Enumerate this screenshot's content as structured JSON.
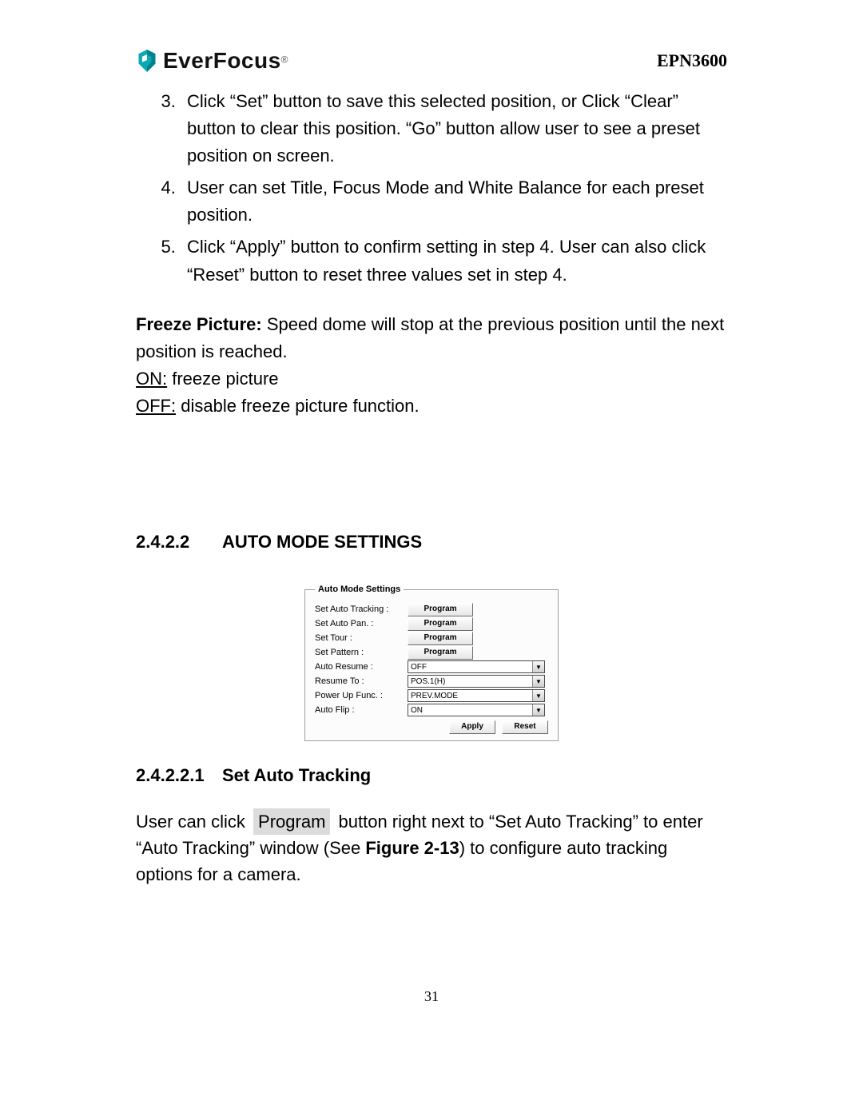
{
  "header": {
    "brand": "EverFocus",
    "model": "EPN3600"
  },
  "instructions": {
    "start": 3,
    "items": [
      "Click “Set” button to save this selected position, or Click “Clear” button to clear this position. “Go” button allow user to see a preset position on screen.",
      "User can set Title, Focus Mode and White Balance for each preset position.",
      "Click “Apply” button to confirm setting in step 4. User can also click “Reset” button to reset three values set in step 4."
    ]
  },
  "freeze": {
    "title": "Freeze Picture:",
    "desc": " Speed dome will stop at the previous position until the next position is reached.",
    "on_label": "ON:",
    "on_desc": " freeze picture",
    "off_label": "OFF:",
    "off_desc": " disable freeze picture function."
  },
  "section": {
    "number": "2.4.2.2",
    "title": "AUTO MODE SETTINGS"
  },
  "panel": {
    "legend": "Auto Mode Settings",
    "program_label": "Program",
    "rows": [
      {
        "label": "Set Auto Tracking :",
        "type": "button"
      },
      {
        "label": "Set Auto Pan. :",
        "type": "button"
      },
      {
        "label": "Set Tour :",
        "type": "button"
      },
      {
        "label": "Set Pattern :",
        "type": "button"
      },
      {
        "label": "Auto Resume :",
        "type": "dropdown",
        "value": "OFF"
      },
      {
        "label": "Resume To :",
        "type": "dropdown",
        "value": "POS.1(H)"
      },
      {
        "label": "Power Up Func. :",
        "type": "dropdown",
        "value": "PREV.MODE"
      },
      {
        "label": "Auto Flip :",
        "type": "dropdown",
        "value": "ON"
      }
    ],
    "apply": "Apply",
    "reset": "Reset"
  },
  "subsection": {
    "number": "2.4.2.2.1",
    "title": "Set Auto Tracking"
  },
  "flow": {
    "pre": "User can click ",
    "btn": "Program",
    "mid": " button right next to “Set Auto Tracking” to enter “Auto Tracking” window (See ",
    "fig": "Figure 2-13",
    "post": ") to configure auto tracking options for a camera."
  },
  "page_number": "31"
}
